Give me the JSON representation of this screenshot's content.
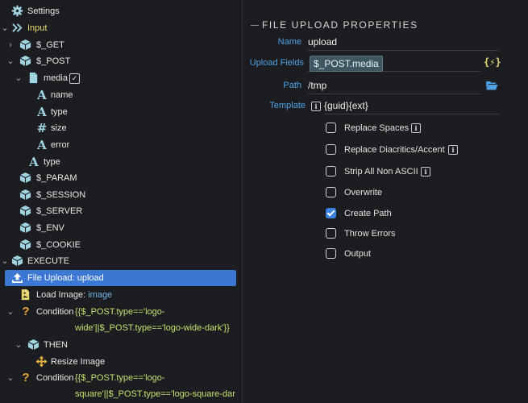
{
  "tree": {
    "settings": "Settings",
    "input": "Input",
    "get": "$_GET",
    "post": "$_POST",
    "media": "media",
    "media_check": "✓",
    "name": "name",
    "type": "type",
    "size": "size",
    "error": "error",
    "type2": "type",
    "param": "$_PARAM",
    "session": "$_SESSION",
    "server": "$_SERVER",
    "env": "$_ENV",
    "cookie": "$_COOKIE",
    "execute": "EXECUTE",
    "file_upload": "File Upload: upload",
    "load_image_prefix": "Load Image: ",
    "load_image_value": "image",
    "condition1_label": "Condition",
    "condition1_line1": "{{$_POST.type=='logo-",
    "condition1_line2": "wide'||$_POST.type=='logo-wide-dark'}}",
    "then": "THEN",
    "resize_image": "Resize Image",
    "condition2_label": "Condition",
    "condition2_line1": "{{$_POST.type=='logo-",
    "condition2_line2": "square'||$_POST.type=='logo-square-dar"
  },
  "properties": {
    "title": "FILE UPLOAD PROPERTIES",
    "name_label": "Name",
    "name_value": "upload",
    "upload_fields_label": "Upload Fields",
    "upload_fields_value": "$_POST.media",
    "dynamic_button": "{⚡}",
    "path_label": "Path",
    "path_value": "/tmp",
    "template_label": "Template",
    "template_value": "{guid}{ext}",
    "info_glyph": "i",
    "options": [
      {
        "label": "Replace Spaces",
        "checked": false,
        "info": true
      },
      {
        "label": "Replace Diacritics/Accent",
        "checked": false,
        "info": true
      },
      {
        "label": "Strip All Non ASCII",
        "checked": false,
        "info": true
      },
      {
        "label": "Overwrite",
        "checked": false,
        "info": false
      },
      {
        "label": "Create Path",
        "checked": true,
        "info": false
      },
      {
        "label": "Throw Errors",
        "checked": false,
        "info": false
      },
      {
        "label": "Output",
        "checked": false,
        "info": false
      }
    ]
  },
  "colors": {
    "background": "#1c1d21",
    "selection": "#3a78d3",
    "label_blue": "#4ea3e6",
    "accent_yellow": "#e8d770",
    "condition_green": "#c3e36e",
    "icon_teal": "#9fd4e0"
  }
}
